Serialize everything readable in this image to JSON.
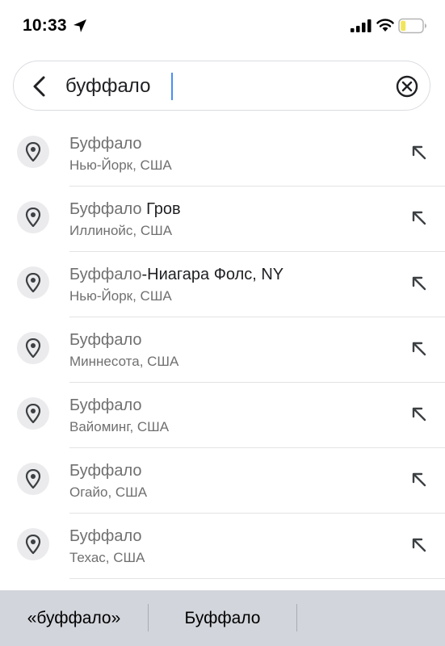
{
  "status_bar": {
    "time": "10:33",
    "icons": [
      "location-arrow-icon",
      "signal-icon",
      "wifi-icon",
      "battery-icon"
    ]
  },
  "search": {
    "value": "буффало",
    "back_icon": "chevron-left-icon",
    "clear_icon": "clear-circle-icon"
  },
  "results": [
    {
      "title_match": "Буффало",
      "title_rest": "",
      "subtitle": "Нью-Йорк, США"
    },
    {
      "title_match": "Буффало",
      "title_rest": " Гров",
      "subtitle": "Иллинойс, США"
    },
    {
      "title_match": "Буффало",
      "title_rest": "-Ниагара Фолс, NY",
      "subtitle": "Нью-Йорк, США"
    },
    {
      "title_match": "Буффало",
      "title_rest": "",
      "subtitle": "Миннесота, США"
    },
    {
      "title_match": "Буффало",
      "title_rest": "",
      "subtitle": "Вайоминг, США"
    },
    {
      "title_match": "Буффало",
      "title_rest": "",
      "subtitle": "Огайо, США"
    },
    {
      "title_match": "Буффало",
      "title_rest": "",
      "subtitle": "Техас, США"
    }
  ],
  "keyboard_suggestions": [
    "«буффало»",
    "Буффало",
    ""
  ],
  "colors": {
    "caret": "#4a8ef2",
    "pin_circle": "#ebebed",
    "suggestion_bar": "#d2d5db",
    "battery_level": "#f2e55c"
  }
}
